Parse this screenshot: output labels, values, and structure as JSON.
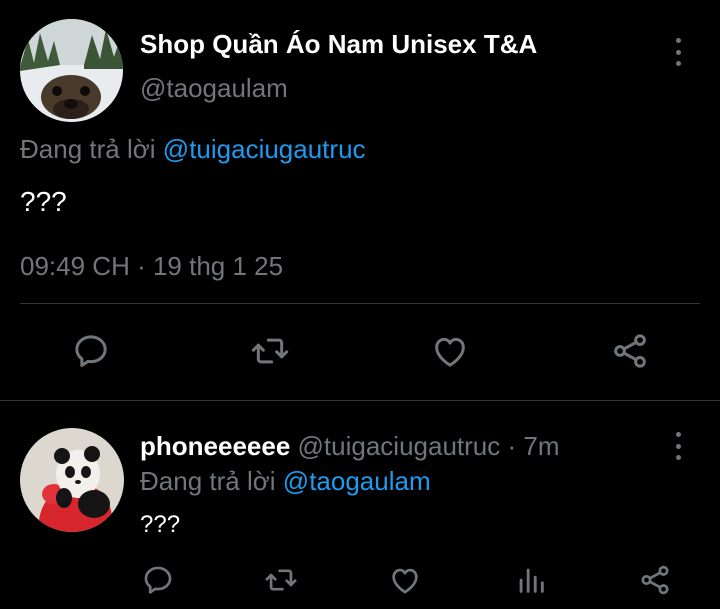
{
  "main_tweet": {
    "display_name": "Shop Quần Áo Nam Unisex T&A",
    "handle": "@taogaulam",
    "reply_prefix": "Đang trả lời",
    "reply_to": "@tuigaciugautruc",
    "text": "???",
    "timestamp": "09:49 CH · 19 thg 1 25",
    "avatar_icon": "otter-face-avatar",
    "actions": [
      "reply-icon",
      "retweet-icon",
      "like-icon",
      "share-icon"
    ]
  },
  "reply_tweet": {
    "display_name": "phoneeeeee",
    "handle": "@tuigaciugautruc",
    "separator": "·",
    "time": "7m",
    "reply_prefix": "Đang trả lời",
    "reply_to": "@taogaulam",
    "text": "???",
    "avatar_icon": "panda-avatar",
    "actions": [
      "reply-icon",
      "retweet-icon",
      "like-icon",
      "analytics-icon",
      "share-icon"
    ]
  },
  "colors": {
    "background": "#000000",
    "primary_text": "#ffffff",
    "secondary_text": "#71767b",
    "link": "#1d9bf0",
    "divider": "#2f3336",
    "icon": "#71767b"
  }
}
